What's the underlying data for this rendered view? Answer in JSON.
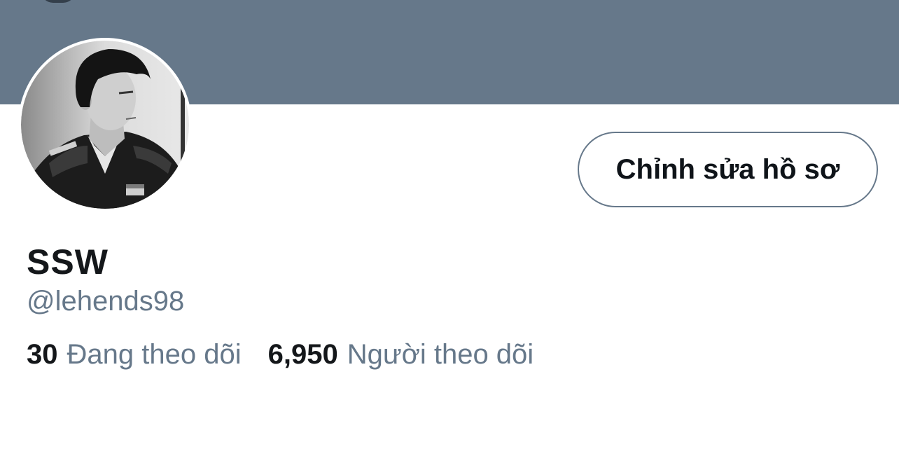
{
  "banner": {
    "color": "#66788a"
  },
  "avatar": {
    "description_icon": "profile-photo"
  },
  "profile": {
    "edit_button_label": "Chỉnh sửa hồ sơ",
    "display_name": "SSW",
    "handle": "@lehends98"
  },
  "stats": {
    "following_count": "30",
    "following_label": "Đang theo dõi",
    "followers_count": "6,950",
    "followers_label": "Người theo dõi"
  }
}
